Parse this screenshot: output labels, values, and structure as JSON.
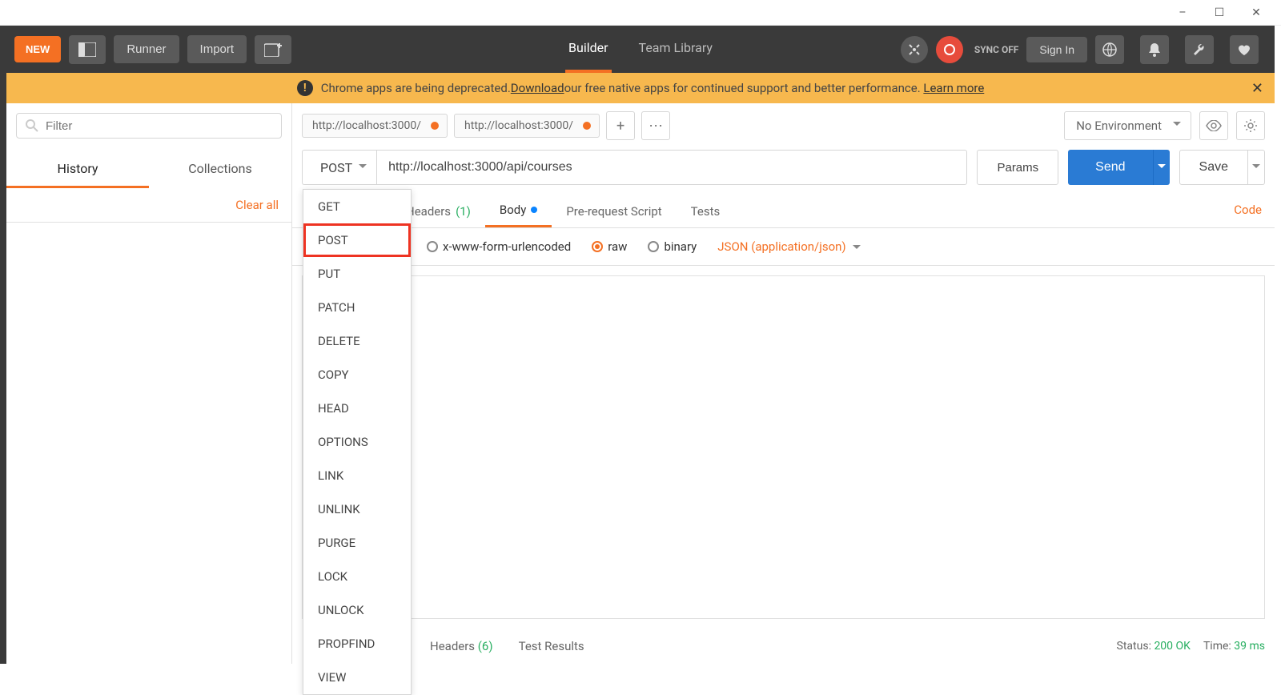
{
  "window": {
    "minimize": "–",
    "maximize": "☐",
    "close": "✕"
  },
  "toolbar": {
    "new": "NEW",
    "runner": "Runner",
    "import": "Import",
    "tabs": {
      "builder": "Builder",
      "team": "Team Library"
    },
    "sync": "SYNC OFF",
    "signin": "Sign In"
  },
  "banner": {
    "text_a": "Chrome apps are being deprecated. ",
    "download": "Download",
    "text_b": " our free native apps for continued support and better performance. ",
    "learn": "Learn more"
  },
  "sidebar": {
    "filter_ph": "Filter",
    "tabs": {
      "history": "History",
      "collections": "Collections"
    },
    "clear": "Clear all"
  },
  "request": {
    "tabs": [
      {
        "label": "http://localhost:3000/"
      },
      {
        "label": "http://localhost:3000/"
      }
    ],
    "env_none": "No Environment",
    "method": "POST",
    "url": "http://localhost:3000/api/courses",
    "params": "Params",
    "send": "Send",
    "save": "Save",
    "mid_headers": "Headers",
    "mid_headers_ct": "(1)",
    "mid_body": "Body",
    "mid_prs": "Pre-request Script",
    "mid_tests": "Tests",
    "code": "Code",
    "body_types": {
      "urlenc": "x-www-form-urlencoded",
      "raw": "raw",
      "binary": "binary"
    },
    "body_fmt": "JSON (application/json)"
  },
  "method_options": [
    "GET",
    "POST",
    "PUT",
    "PATCH",
    "DELETE",
    "COPY",
    "HEAD",
    "OPTIONS",
    "LINK",
    "UNLINK",
    "PURGE",
    "LOCK",
    "UNLOCK",
    "PROPFIND",
    "VIEW"
  ],
  "method_highlight": "POST",
  "response": {
    "tabs": {
      "headers": "Headers",
      "headers_ct": "(6)",
      "testres": "Test Results"
    },
    "status_lbl": "Status:",
    "status": "200 OK",
    "time_lbl": "Time:",
    "time": "39 ms"
  }
}
